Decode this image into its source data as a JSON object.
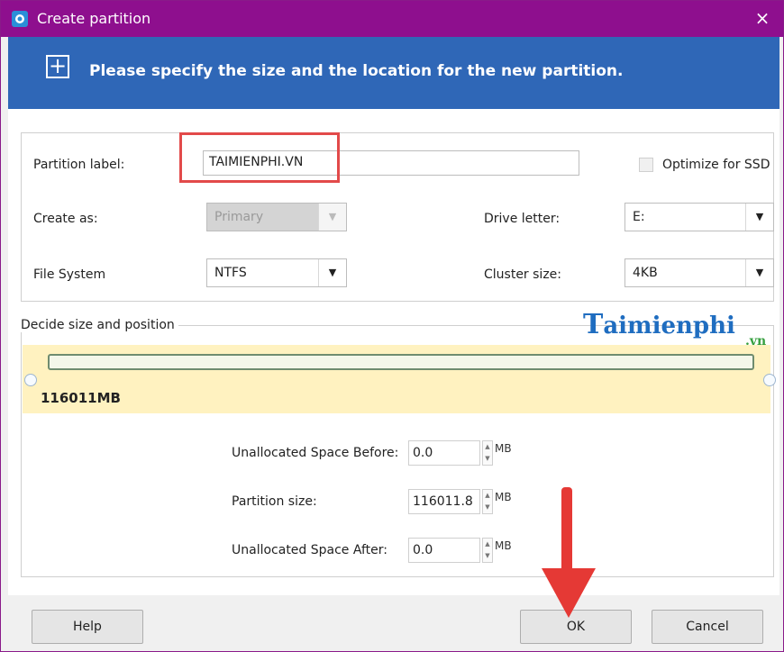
{
  "window": {
    "title": "Create partition",
    "close_glyph": "×"
  },
  "banner": {
    "text": "Please specify the size and the location for the new partition."
  },
  "form": {
    "partition_label": {
      "label": "Partition label:",
      "value": "TAIMIENPHI.VN"
    },
    "optimize_ssd": {
      "label": "Optimize for SSD",
      "checked": false
    },
    "create_as": {
      "label": "Create as:",
      "value": "Primary",
      "disabled": true
    },
    "drive_letter": {
      "label": "Drive letter:",
      "value": "E:"
    },
    "file_system": {
      "label": "File System",
      "value": "NTFS"
    },
    "cluster_size": {
      "label": "Cluster size:",
      "value": "4KB"
    }
  },
  "size_section": {
    "legend": "Decide size and position",
    "partition_size_display": "116011MB",
    "watermark": {
      "logo_letter": "T",
      "text": "aimienphi",
      "suffix": ".vn"
    },
    "fields": [
      {
        "label": "Unallocated Space Before:",
        "value": "0.0",
        "unit": "MB"
      },
      {
        "label": "Partition size:",
        "value": "116011.8",
        "unit": "MB"
      },
      {
        "label": "Unallocated Space After:",
        "value": "0.0",
        "unit": "MB"
      }
    ]
  },
  "buttons": {
    "help": "Help",
    "ok": "OK",
    "cancel": "Cancel"
  },
  "colors": {
    "titlebar": "#8e0f8e",
    "banner": "#2f67b7",
    "highlight": "#e24a4a",
    "arrow": "#e53935",
    "size_area": "#fff2c0"
  }
}
